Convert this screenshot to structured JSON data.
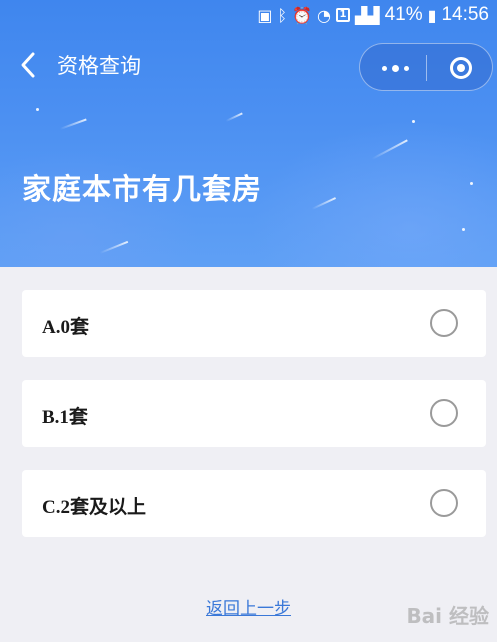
{
  "status_bar": {
    "battery_percent": "41%",
    "time": "14:56",
    "sim_label": "1",
    "icons": [
      "nfc-icon",
      "bluetooth-icon",
      "alarm-icon",
      "wifi-icon",
      "sim-icon",
      "signal-icon",
      "battery-icon"
    ]
  },
  "nav": {
    "title": "资格查询",
    "back_icon": "chevron-left-icon",
    "capsule": {
      "more_icon": "more-dots-icon",
      "close_icon": "target-close-icon"
    }
  },
  "question": {
    "text": "家庭本市有几套房"
  },
  "options": [
    {
      "label": "A.0套",
      "selected": false
    },
    {
      "label": "B.1套",
      "selected": false
    },
    {
      "label": "C.2套及以上",
      "selected": false
    }
  ],
  "footer": {
    "back_link": "返回上一步"
  },
  "watermark": {
    "text": "Bai 经验"
  },
  "colors": {
    "header_blue": "#4c90f2",
    "page_bg": "#efeff4",
    "link_blue": "#3a78d8",
    "radio_border": "#9a9a9a"
  }
}
